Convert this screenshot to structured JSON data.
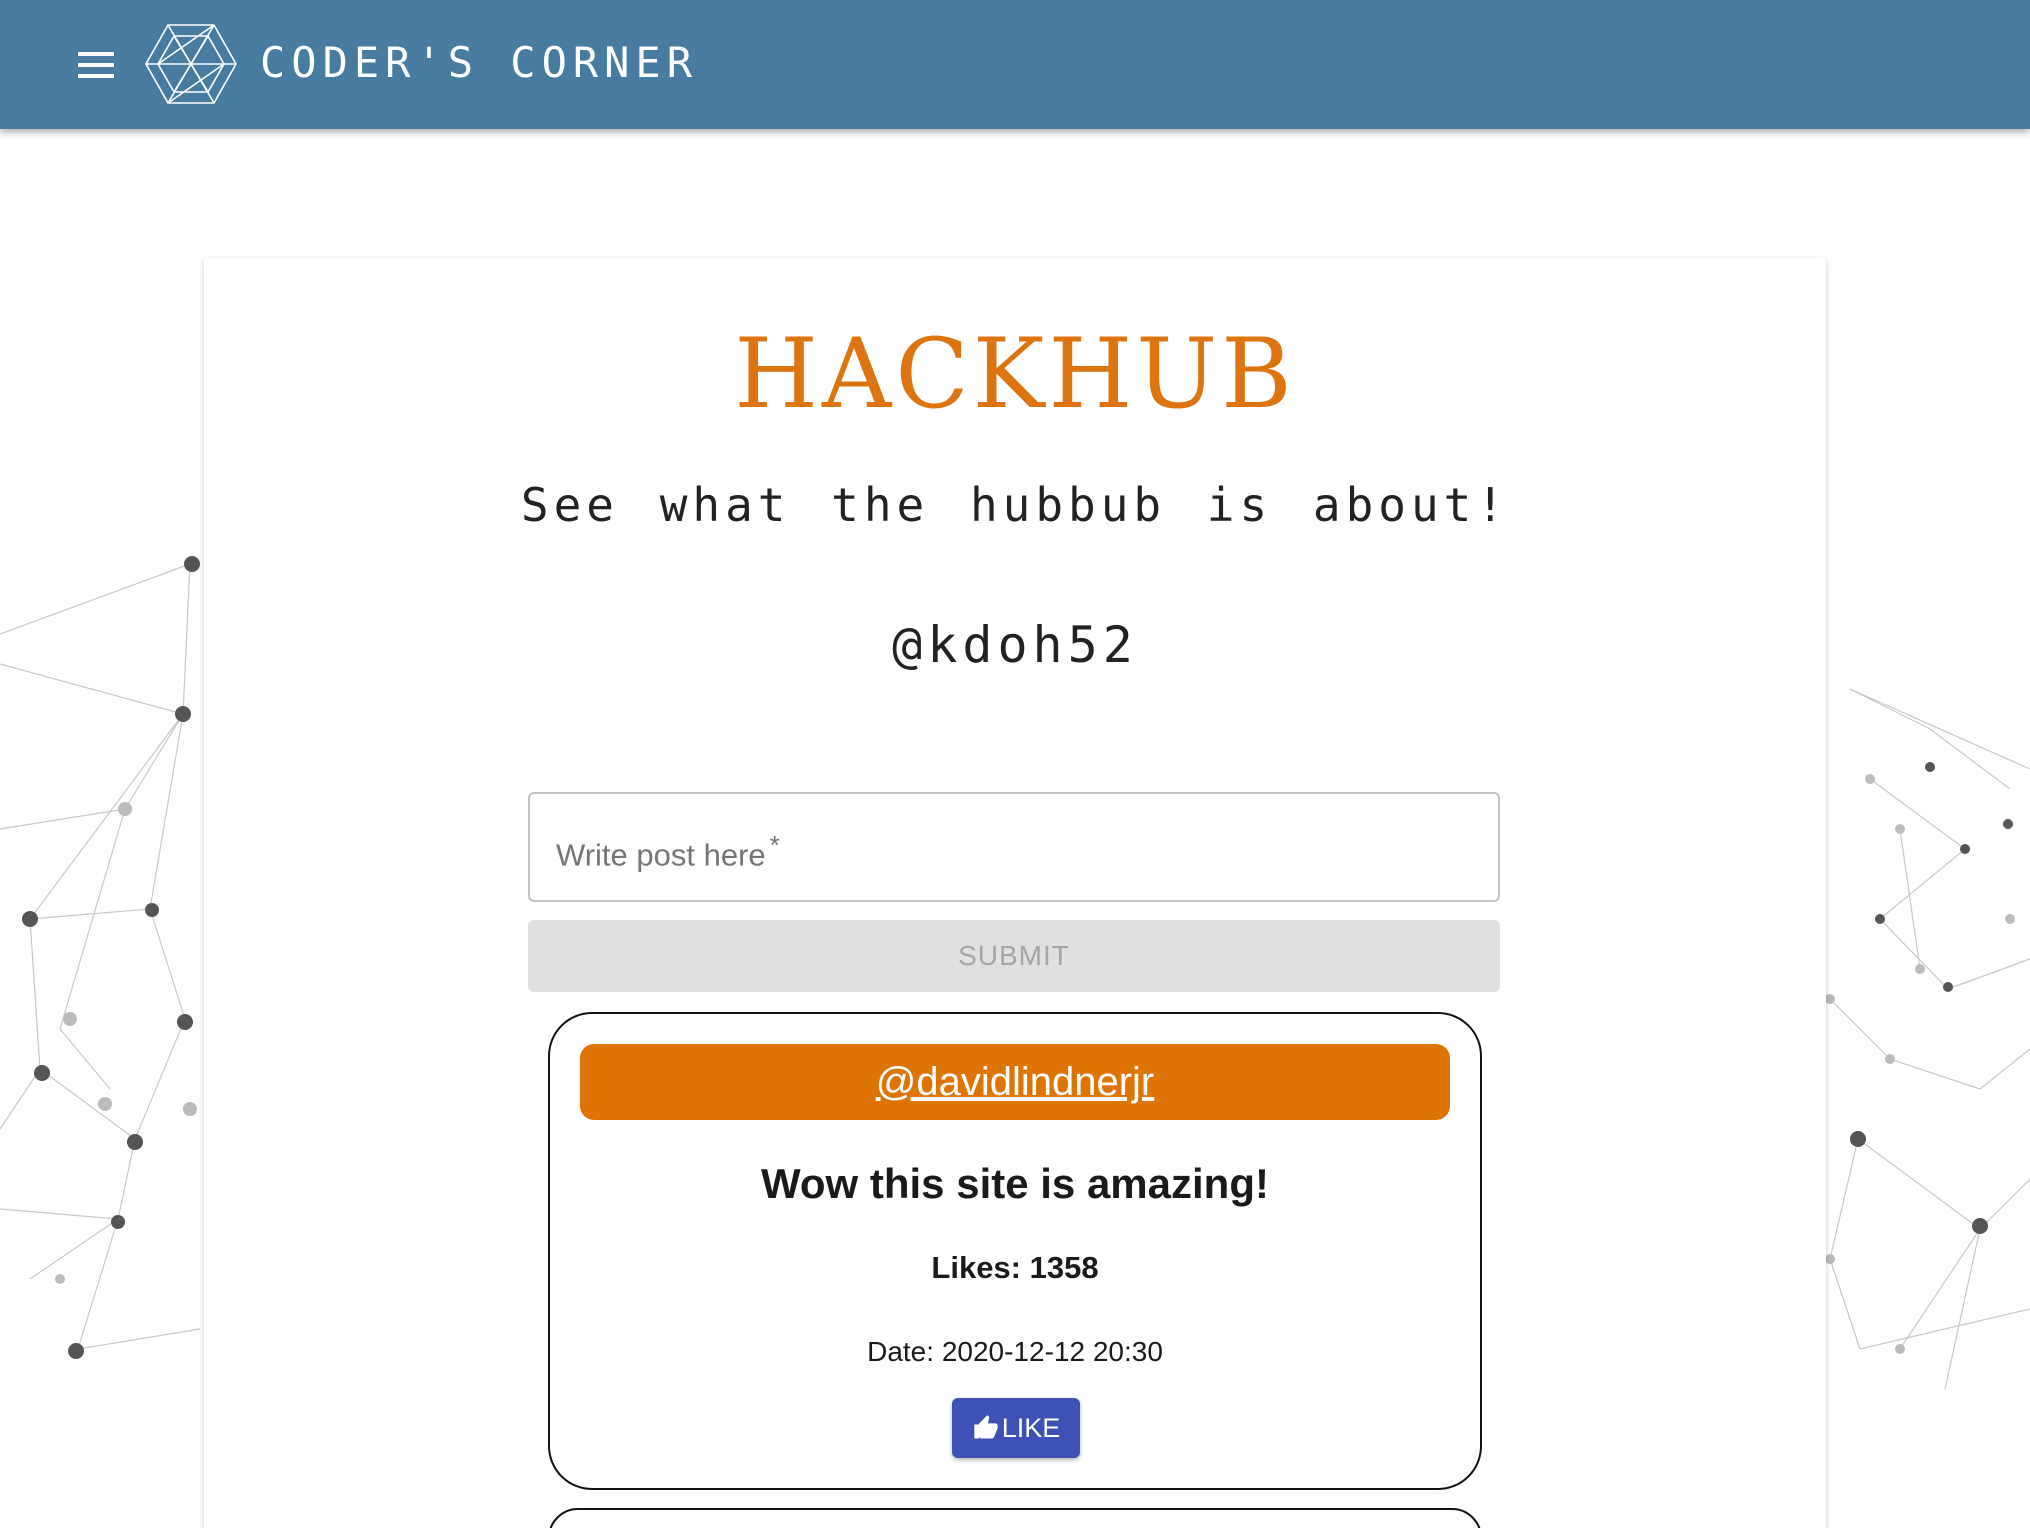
{
  "header": {
    "brand": "CODER'S CORNER",
    "menu_icon": "hamburger-menu-icon",
    "logo_icon": "hexagon-network-logo-icon",
    "background_color": "#477b9f"
  },
  "main": {
    "title": "HACKHUB",
    "subtitle": "See what the hubbub is about!",
    "handle": "@kdoh52",
    "post_input": {
      "placeholder": "Write post here",
      "required_marker": "*"
    },
    "submit_label": "SUBMIT",
    "accent_color": "#dd7410"
  },
  "posts": [
    {
      "author": "@davidlindnerjr",
      "body": "Wow this site is amazing!",
      "likes": "Likes: 1358",
      "date": "Date: 2020-12-12 20:30",
      "like_label": "LIKE",
      "like_icon": "thumbs-up-icon"
    }
  ]
}
